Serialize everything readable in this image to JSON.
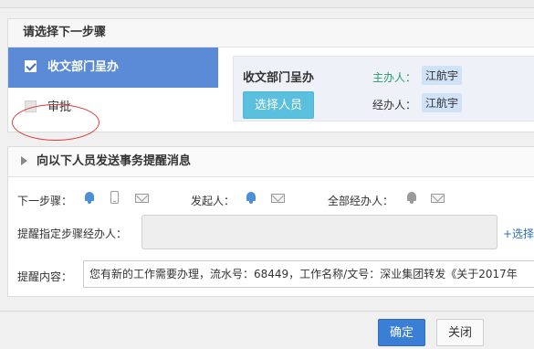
{
  "step_panel": {
    "title": "请选择下一步骤",
    "steps": [
      {
        "label": "收文部门呈办",
        "checked": true
      },
      {
        "label": "审批",
        "checked": false
      }
    ],
    "detail": {
      "step_name": "收文部门呈办",
      "select_button": "选择人员",
      "host_label": "主办人：",
      "host_value": "江航宇",
      "handler_label": "经办人：",
      "handler_value": "江航宇"
    }
  },
  "notify_panel": {
    "title": "向以下人员发送事务提醒消息",
    "next_step_label": "下一步骤：",
    "initiator_label": "发起人：",
    "all_handlers_label": "全部经办人：",
    "designated_label": "提醒指定步骤经办人：",
    "add_link": "+选择",
    "content_label": "提醒内容：",
    "content_value": "您有新的工作需要办理，流水号：68449，工作名称/文号：深业集团转发《关于2017年"
  },
  "footer": {
    "ok_label": "确定",
    "close_label": "关闭"
  },
  "colors": {
    "active_step": "#5b8bd6",
    "select_button": "#5bc0de",
    "ok_button": "#3a7fd5",
    "host_label": "#2a9d6a",
    "annotation": "#e03c3c"
  }
}
